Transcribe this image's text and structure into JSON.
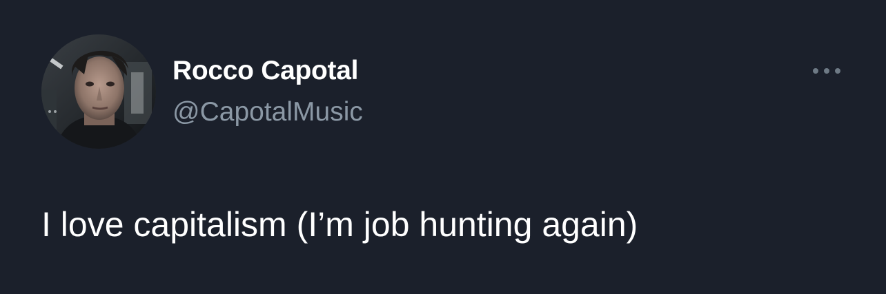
{
  "tweet": {
    "author": {
      "display_name": "Rocco Capotal",
      "handle": "@CapotalMusic",
      "avatar_icon": "profile-photo"
    },
    "more_icon": "more-horizontal-icon",
    "text": "I love capitalism (I’m job hunting again)"
  },
  "colors": {
    "background": "#1b202b",
    "primary_text": "#ffffff",
    "secondary_text": "#8b98a5"
  }
}
